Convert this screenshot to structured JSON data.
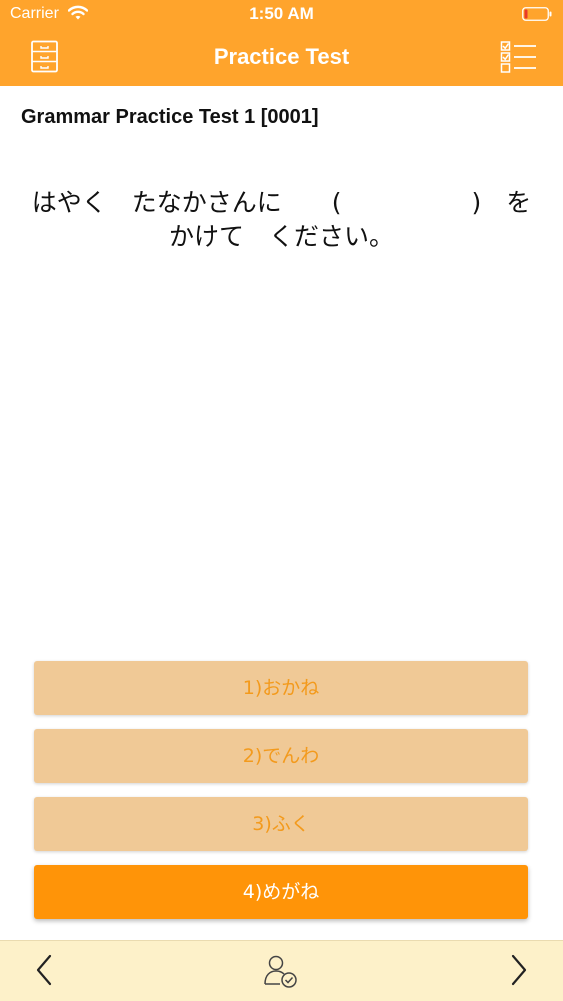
{
  "status_bar": {
    "carrier": "Carrier",
    "time": "1:50 AM"
  },
  "nav": {
    "title": "Practice Test",
    "left_icon": "drawer-cabinet-icon",
    "right_icon": "checklist-icon"
  },
  "test": {
    "title": "Grammar Practice Test 1 [0001]",
    "question": {
      "line1_part1": "はやく　たなかさんに　　(",
      "line1_part2": ")　を",
      "line2": "かけて　ください。"
    },
    "options": [
      {
        "label": "1)おかね",
        "state": "normal"
      },
      {
        "label": "2)でんわ",
        "state": "normal"
      },
      {
        "label": "3)ふく",
        "state": "normal"
      },
      {
        "label": "4)めがね",
        "state": "selected"
      }
    ]
  },
  "toolbar": {
    "prev_icon": "chevron-left-icon",
    "center_icon": "user-check-icon",
    "next_icon": "chevron-right-icon"
  },
  "colors": {
    "header": "#ffa42c",
    "option_normal_bg": "#f0c996",
    "option_normal_text": "#f39a1c",
    "option_selected_bg": "#ff9408",
    "toolbar_bg": "#fdf1c9"
  }
}
